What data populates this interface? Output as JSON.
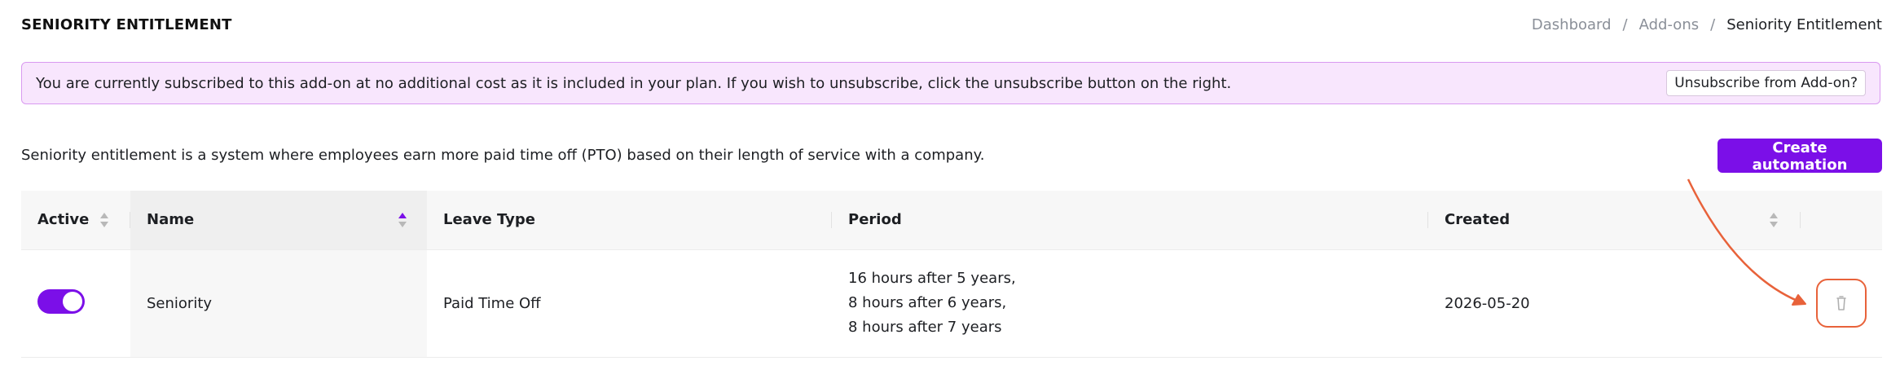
{
  "header": {
    "title": "SENIORITY ENTITLEMENT",
    "breadcrumb": [
      "Dashboard",
      "Add-ons",
      "Seniority Entitlement"
    ],
    "breadcrumb_separator": "/"
  },
  "notice": {
    "text": "You are currently subscribed to this add-on at no additional cost as it is included in your plan. If you wish to unsubscribe, click the unsubscribe button on the right.",
    "unsubscribe_label": "Unsubscribe from Add-on?"
  },
  "description": "Seniority entitlement is a system where employees earn more paid time off (PTO) based on their length of service with a company.",
  "create_button_label": "Create automation",
  "table": {
    "columns": [
      "Active",
      "Name",
      "Leave Type",
      "Period",
      "Created",
      ""
    ],
    "rows": [
      {
        "active": true,
        "name": "Seniority",
        "leave_type": "Paid Time Off",
        "period": [
          "16 hours after 5 years,",
          "8 hours after 6 years,",
          "8 hours after 7 years"
        ],
        "created": "2026-05-20"
      }
    ]
  },
  "colors": {
    "accent": "#7b0fe8",
    "notice_bg": "#f8e6fd",
    "highlight": "#e8623a"
  },
  "icons": {
    "sort": "sort-icon",
    "delete": "trash-icon"
  }
}
